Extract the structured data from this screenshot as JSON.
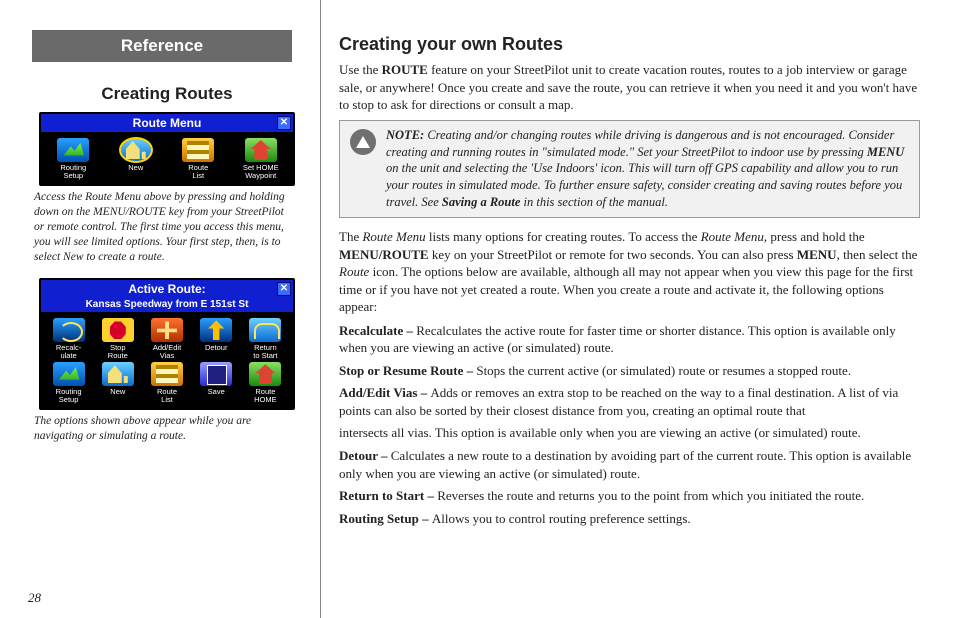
{
  "left": {
    "banner": "Reference",
    "heading": "Creating Routes",
    "shot1": {
      "title": "Route Menu",
      "items": [
        {
          "label": "Routing\nSetup",
          "ico": "i-setup"
        },
        {
          "label": "New",
          "ico": "i-new",
          "hl": true
        },
        {
          "label": "Route\nList",
          "ico": "i-list"
        },
        {
          "label": "Set HOME\nWaypoint",
          "ico": "i-home"
        }
      ]
    },
    "cap1": "Access the Route Menu above by pressing and holding down on the MENU/ROUTE key from your StreetPilot or remote control. The first time you access this menu, you will see limited options. Your first step, then, is to select New to create a route.",
    "shot2": {
      "title": "Active Route:",
      "subtitle": "Kansas Speedway from E 151st St",
      "items": [
        {
          "label": "Recalc-\nulate",
          "ico": "i-recalc"
        },
        {
          "label": "Stop\nRoute",
          "ico": "i-stop"
        },
        {
          "label": "Add/Edit\nVias",
          "ico": "i-vias"
        },
        {
          "label": "Detour",
          "ico": "i-detour"
        },
        {
          "label": "Return\nto Start",
          "ico": "i-return"
        },
        {
          "label": "Routing\nSetup",
          "ico": "i-setup"
        },
        {
          "label": "New",
          "ico": "i-new"
        },
        {
          "label": "Route\nList",
          "ico": "i-list"
        },
        {
          "label": "Save",
          "ico": "i-save"
        },
        {
          "label": "Route\nHOME",
          "ico": "i-home"
        }
      ]
    },
    "cap2": "The options shown above appear while you are navigating or simulating a route.",
    "pageNum": "28"
  },
  "right": {
    "heading": "Creating your own Routes",
    "p1_a": "Use the ",
    "p1_b": "ROUTE",
    "p1_c": " feature on your StreetPilot unit to create vacation routes, routes to a job interview or garage sale, or anywhere! Once you create and save the route, you can retrieve it when you need it and you won't have to stop to ask for directions or consult a map.",
    "note_a": "NOTE:",
    "note_b": " Creating and/or changing routes while driving is dangerous and is not encouraged. Consider creating and running routes in \"simulated mode.\" Set your StreetPilot to indoor use by pressing ",
    "note_c": "MENU",
    "note_d": " on the unit and selecting the 'Use Indoors' icon. This will turn off GPS capability and allow you to run your routes in simulated mode. To further ensure safety, consider creating and saving routes before you travel. See ",
    "note_e": "Saving a Route",
    "note_f": " in this section of the manual.",
    "p2_a": "The ",
    "p2_b": "Route Menu",
    "p2_c": " lists many options for creating routes. To access the ",
    "p2_d": "Route Menu",
    "p2_e": ", press and hold the ",
    "p2_f": "MENU/ROUTE",
    "p2_g": " key on your StreetPilot or remote for two seconds. You can also press ",
    "p2_h": "MENU",
    "p2_i": ", then select the ",
    "p2_j": "Route",
    "p2_k": " icon. The options below are available, although all may not appear when you view this page for the first time or if you have not yet created a route. When you create a route and activate it, the following options appear:",
    "opts": {
      "recalc_t": "Recalculate – ",
      "recalc_d": "Recalculates the active route for faster time or shorter distance. This option is available only when you are viewing an active (or simulated) route.",
      "stop_t": "Stop or Resume Route – ",
      "stop_d": "Stops the current active (or simulated) route or resumes a stopped route.",
      "vias_t": "Add/Edit Vias – ",
      "vias_d": "Adds or removes an extra stop to be reached on the way to a final destination. A list of via points can also be sorted by their closest distance from you, creating an optimal route that",
      "vias_d2": "intersects all vias. This option is available only when you are viewing an active (or simulated) route.",
      "detour_t": "Detour – ",
      "detour_d": "Calculates a new route to a destination by avoiding part of the current route. This option is available only when you are viewing an active (or simulated) route.",
      "return_t": "Return to Start – ",
      "return_d": "Reverses the route and returns you to the point from which you initiated the route.",
      "setup_t": "Routing Setup – ",
      "setup_d": "Allows you to control routing preference settings."
    }
  }
}
